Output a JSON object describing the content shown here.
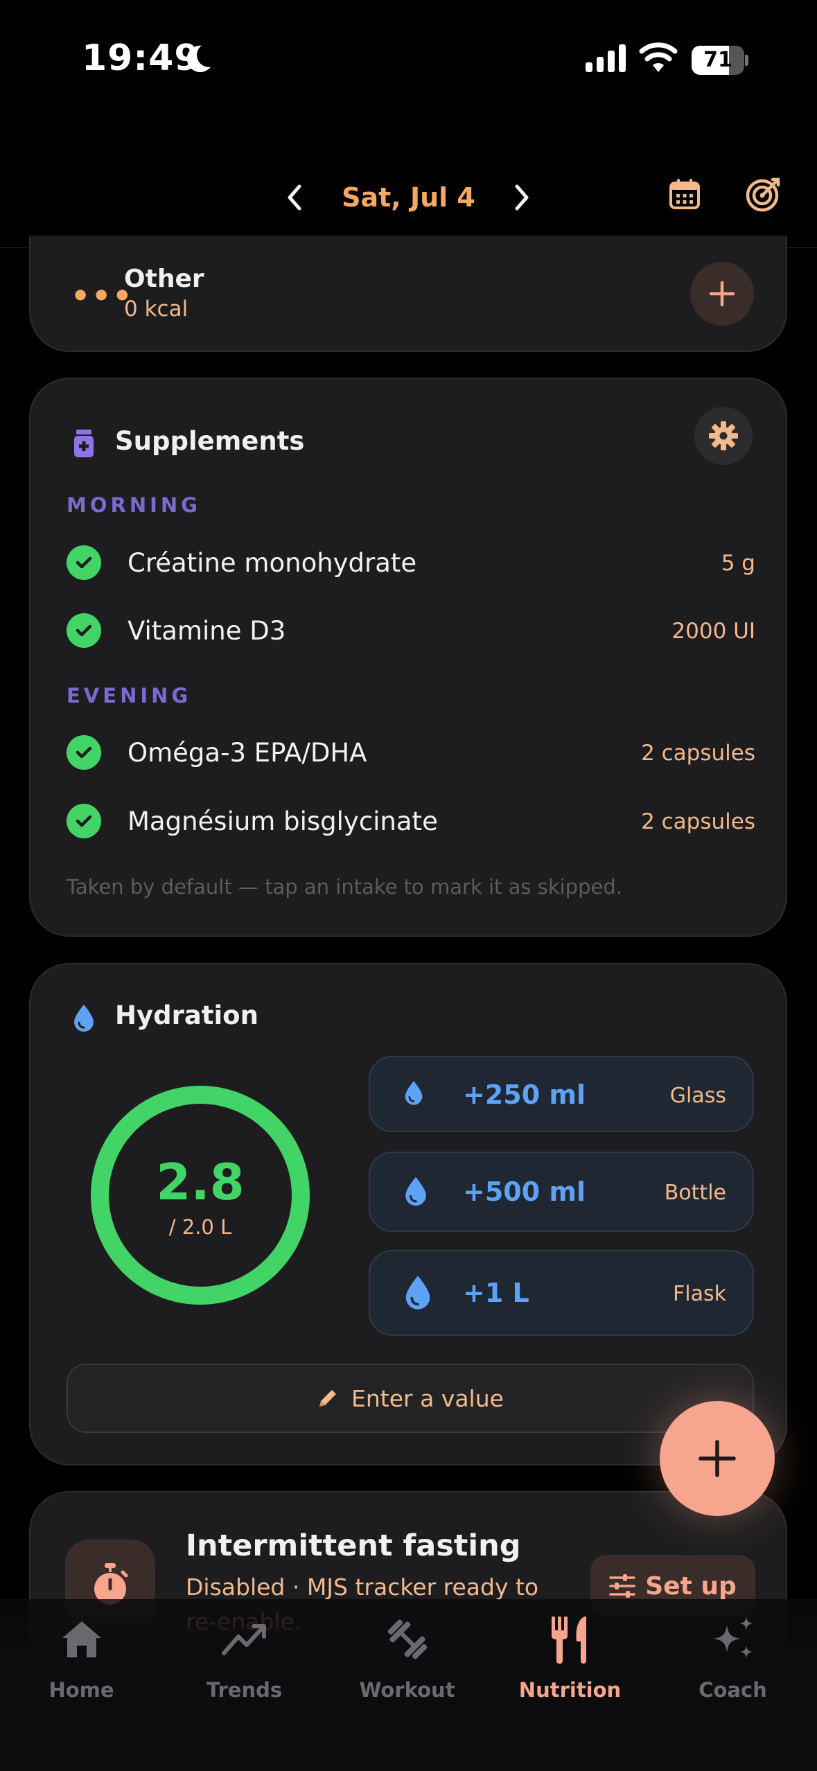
{
  "status_bar": {
    "time": "19:49",
    "battery": "71",
    "battery_fraction": 0.71
  },
  "header": {
    "date": "Sat, Jul 4"
  },
  "other": {
    "title": "Other",
    "kcal": "0 kcal"
  },
  "supplements": {
    "title": "Supplements",
    "periods": [
      {
        "label": "MORNING",
        "items": [
          {
            "name": "Créatine monohydrate",
            "dose": "5 g"
          },
          {
            "name": "Vitamine D3",
            "dose": "2000 UI"
          }
        ]
      },
      {
        "label": "EVENING",
        "items": [
          {
            "name": "Oméga-3 EPA/DHA",
            "dose": "2 capsules"
          },
          {
            "name": "Magnésium bisglycinate",
            "dose": "2 capsules"
          }
        ]
      }
    ],
    "hint": "Taken by default — tap an intake to mark it as skipped."
  },
  "hydration": {
    "title": "Hydration",
    "value": "2.8",
    "target": "/ 2.0 L",
    "progress": 1.0,
    "buttons": [
      {
        "amount": "+250 ml",
        "kind": "Glass"
      },
      {
        "amount": "+500 ml",
        "kind": "Bottle"
      },
      {
        "amount": "+1 L",
        "kind": "Flask"
      }
    ],
    "enter_label": "Enter a value"
  },
  "fasting": {
    "title": "Intermittent fasting",
    "description": "Disabled · MJS tracker ready to re-enable.",
    "setup_label": "Set up"
  },
  "tabs": [
    {
      "label": "Home",
      "icon": "home-icon"
    },
    {
      "label": "Trends",
      "icon": "trends-icon"
    },
    {
      "label": "Workout",
      "icon": "dumbbell-icon"
    },
    {
      "label": "Nutrition",
      "icon": "fork-knife-icon",
      "active": true
    },
    {
      "label": "Coach",
      "icon": "sparkles-icon"
    }
  ],
  "colors": {
    "accent": "#f5a85f",
    "green": "#42d467",
    "blue": "#5da2f5",
    "purple": "#7d6ad1",
    "peach": "#f8a58d"
  }
}
